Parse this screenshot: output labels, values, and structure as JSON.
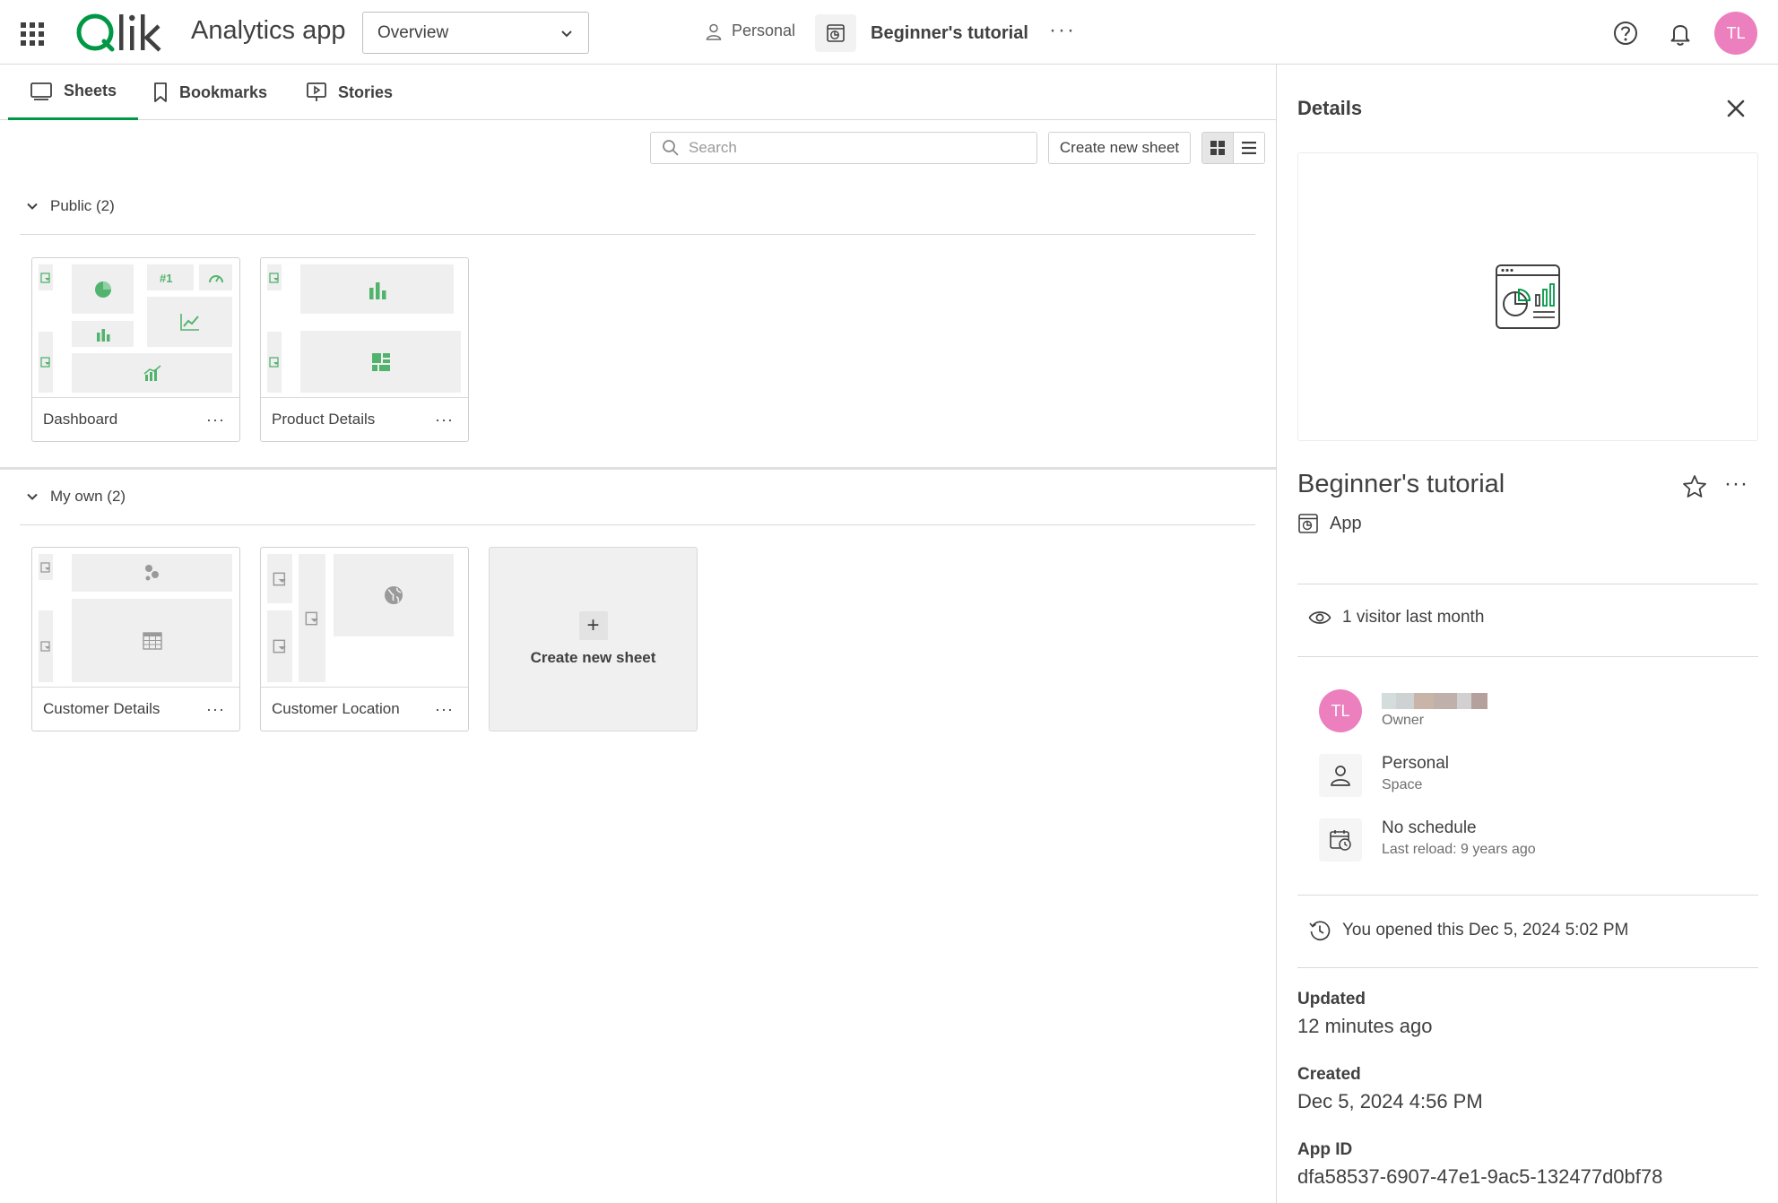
{
  "topbar": {
    "app_title": "Analytics app",
    "view_select": "Overview",
    "space_label": "Personal",
    "app_name": "Beginner's tutorial",
    "more": "···",
    "avatar_initials": "TL"
  },
  "tabs": [
    {
      "label": "Sheets",
      "active": true
    },
    {
      "label": "Bookmarks",
      "active": false
    },
    {
      "label": "Stories",
      "active": false
    }
  ],
  "toolbar": {
    "search_placeholder": "Search",
    "create_label": "Create new sheet"
  },
  "sections": {
    "public": {
      "label": "Public (2)",
      "sheets": [
        "Dashboard",
        "Product Details"
      ]
    },
    "my_own": {
      "label": "My own (2)",
      "sheets": [
        "Customer Details",
        "Customer Location"
      ]
    }
  },
  "new_sheet_card": {
    "plus": "+",
    "label": "Create new sheet"
  },
  "card_more": "···",
  "details": {
    "title": "Details",
    "app_name": "Beginner's tutorial",
    "type": "App",
    "more": "···",
    "visitors": "1 visitor last month",
    "owner": {
      "initials": "TL",
      "label": "Owner"
    },
    "space": {
      "name": "Personal",
      "label": "Space"
    },
    "schedule": {
      "name": "No schedule",
      "label": "Last reload: 9 years ago"
    },
    "opened": "You opened this Dec 5, 2024 5:02 PM",
    "updated": {
      "label": "Updated",
      "value": "12 minutes ago"
    },
    "created": {
      "label": "Created",
      "value": "Dec 5, 2024 4:56 PM"
    },
    "app_id": {
      "label": "App ID",
      "value": "dfa58537-6907-47e1-9ac5-132477d0bf78"
    }
  },
  "colors": {
    "accent": "#009845",
    "chart_green": "#52b36e",
    "avatar": "#ec7fbe",
    "qlik_green": "#009845"
  }
}
